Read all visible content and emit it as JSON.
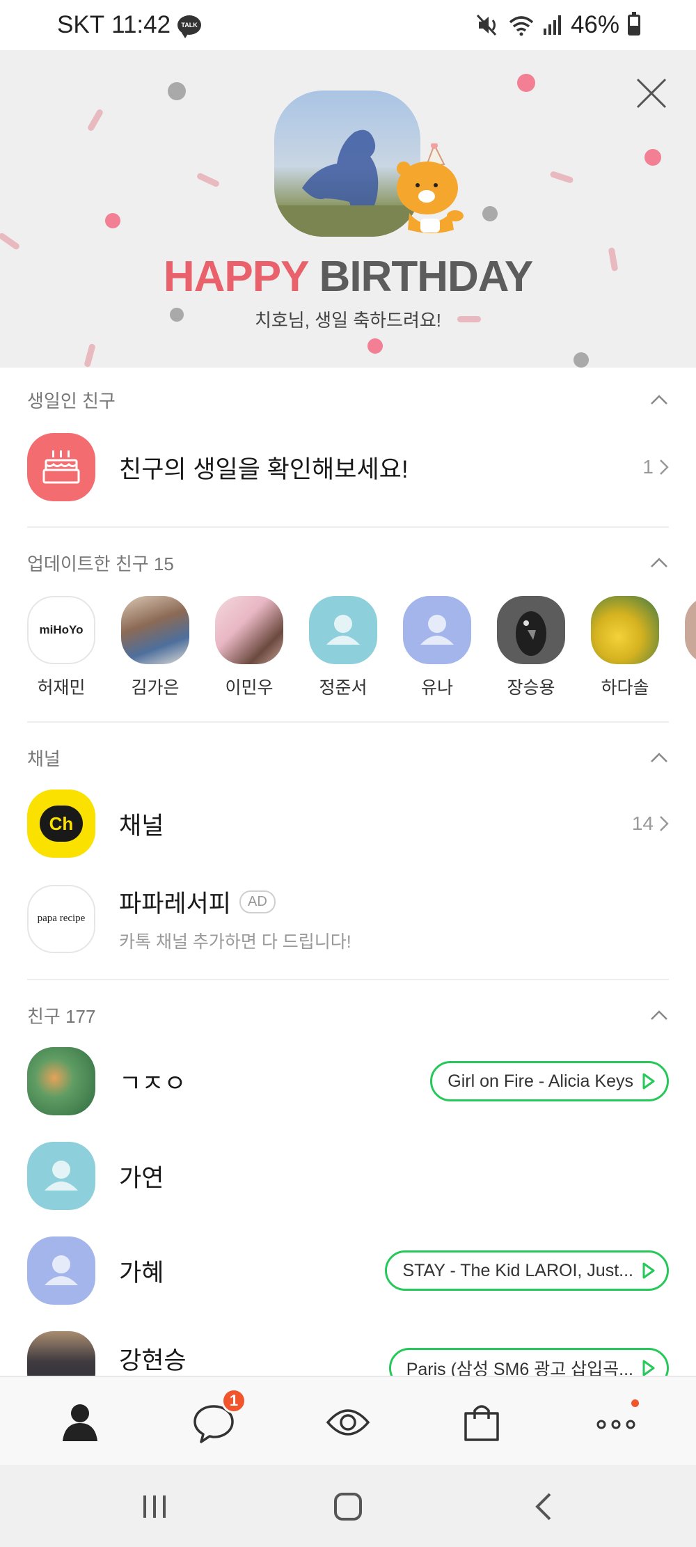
{
  "status_bar": {
    "carrier": "SKT",
    "time": "11:42",
    "talk_badge": "TALK",
    "battery": "46%",
    "battery_level": 0.46
  },
  "banner": {
    "title_happy": "HAPPY",
    "title_birthday": "BIRTHDAY",
    "subtitle": "치호님, 생일 축하드려요!"
  },
  "birthday_section": {
    "header": "생일인 친구",
    "row_label": "친구의 생일을 확인해보세요!",
    "count": "1"
  },
  "updated_section": {
    "header": "업데이트한 친구 15",
    "friends": [
      {
        "name": "허재민",
        "avatar_text": "miHoYo"
      },
      {
        "name": "김가은"
      },
      {
        "name": "이민우"
      },
      {
        "name": "정준서"
      },
      {
        "name": "유나"
      },
      {
        "name": "장승용"
      },
      {
        "name": "하다솔"
      }
    ]
  },
  "channel_section": {
    "header": "채널",
    "channel_label": "채널",
    "channel_logo_text": "Ch",
    "channel_count": "14",
    "ad_name": "파파레서피",
    "ad_badge": "AD",
    "ad_logo_text": "papa recipe",
    "ad_desc": "카톡 채널 추가하면 다 드립니다!"
  },
  "friends_section": {
    "header": "친구 177",
    "friends": [
      {
        "name": "ㄱㅈㅇ",
        "music": "Girl on Fire - Alicia Keys"
      },
      {
        "name": "가연"
      },
      {
        "name": "가혜",
        "music": "STAY - The Kid LAROI, Just..."
      },
      {
        "name": "강현승",
        "music": "Paris (삼성 SM6 광고 삽입곡..."
      }
    ]
  },
  "bottom_nav": {
    "chat_badge": "1"
  },
  "colors": {
    "accent_green": "#27c85a",
    "badge_red": "#f0552c",
    "happy_pink": "#e9616b",
    "kakao_yellow": "#fae100"
  }
}
